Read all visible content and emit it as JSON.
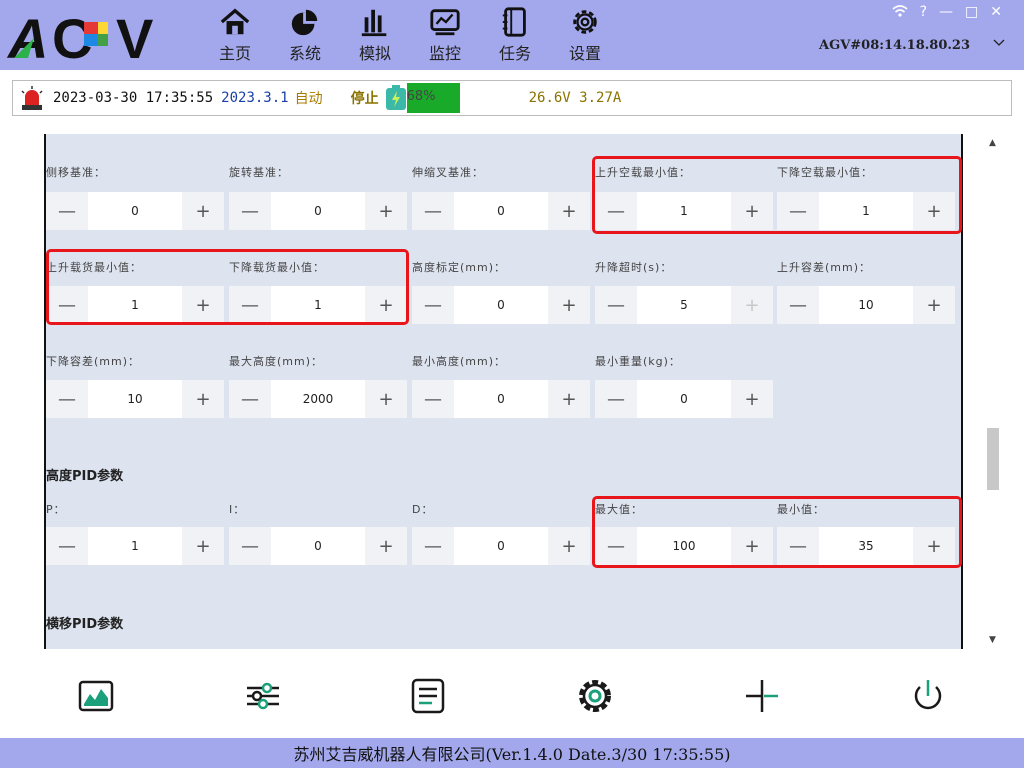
{
  "header": {
    "logo_text": "AGV",
    "nav": [
      {
        "label": "主页",
        "icon": "home-icon"
      },
      {
        "label": "系统",
        "icon": "pie-chart-icon"
      },
      {
        "label": "模拟",
        "icon": "bar-chart-icon"
      },
      {
        "label": "监控",
        "icon": "monitor-icon"
      },
      {
        "label": "任务",
        "icon": "notebook-icon"
      },
      {
        "label": "设置",
        "icon": "gear-icon"
      }
    ],
    "window_controls": {
      "help": "?",
      "minimize": "—",
      "maximize": "□",
      "close": "✕"
    },
    "agv_id": "AGV#08:14.18.80.23"
  },
  "status": {
    "datetime": "2023-03-30 17:35:55",
    "version": "2023.3.1",
    "mode": "自动",
    "state": "停止",
    "battery_percent": 68,
    "battery_text": "68%",
    "voltage_current": "26.6V 3.27A"
  },
  "params": {
    "rows": [
      [
        {
          "label": "侧移基准：",
          "value": "0"
        },
        {
          "label": "旋转基准：",
          "value": "0"
        },
        {
          "label": "伸缩叉基准：",
          "value": "0"
        },
        {
          "label": "上升空载最小值：",
          "value": "1"
        },
        {
          "label": "下降空载最小值：",
          "value": "1"
        }
      ],
      [
        {
          "label": "上升载货最小值：",
          "value": "1"
        },
        {
          "label": "下降载货最小值：",
          "value": "1"
        },
        {
          "label": "高度标定(mm)：",
          "value": "0"
        },
        {
          "label": "升降超时(s)：",
          "value": "5"
        },
        {
          "label": "上升容差(mm)：",
          "value": "10"
        }
      ],
      [
        {
          "label": "下降容差(mm)：",
          "value": "10"
        },
        {
          "label": "最大高度(mm)：",
          "value": "2000"
        },
        {
          "label": "最小高度(mm)：",
          "value": "0"
        },
        {
          "label": "最小重量(kg)：",
          "value": "0"
        }
      ]
    ],
    "height_pid_title": "高度PID参数",
    "height_pid": [
      {
        "label": "P：",
        "value": "1"
      },
      {
        "label": "I：",
        "value": "0"
      },
      {
        "label": "D：",
        "value": "0"
      },
      {
        "label": "最大值：",
        "value": "100"
      },
      {
        "label": "最小值：",
        "value": "35"
      }
    ],
    "lateral_pid_title": "横移PID参数",
    "minus": "—",
    "plus": "+"
  },
  "scroll": {
    "up": "▲",
    "down": "▼"
  },
  "footer": {
    "text": "苏州艾吉威机器人有限公司(Ver.1.4.0 Date.3/30 17:35:55)"
  },
  "colors": {
    "header_bg": "#a3a8ec",
    "panel_bg": "#dde3ef",
    "battery_green": "#19aa2a",
    "highlight_red": "#e8151a",
    "toolbar_teal": "#1aa07a"
  }
}
